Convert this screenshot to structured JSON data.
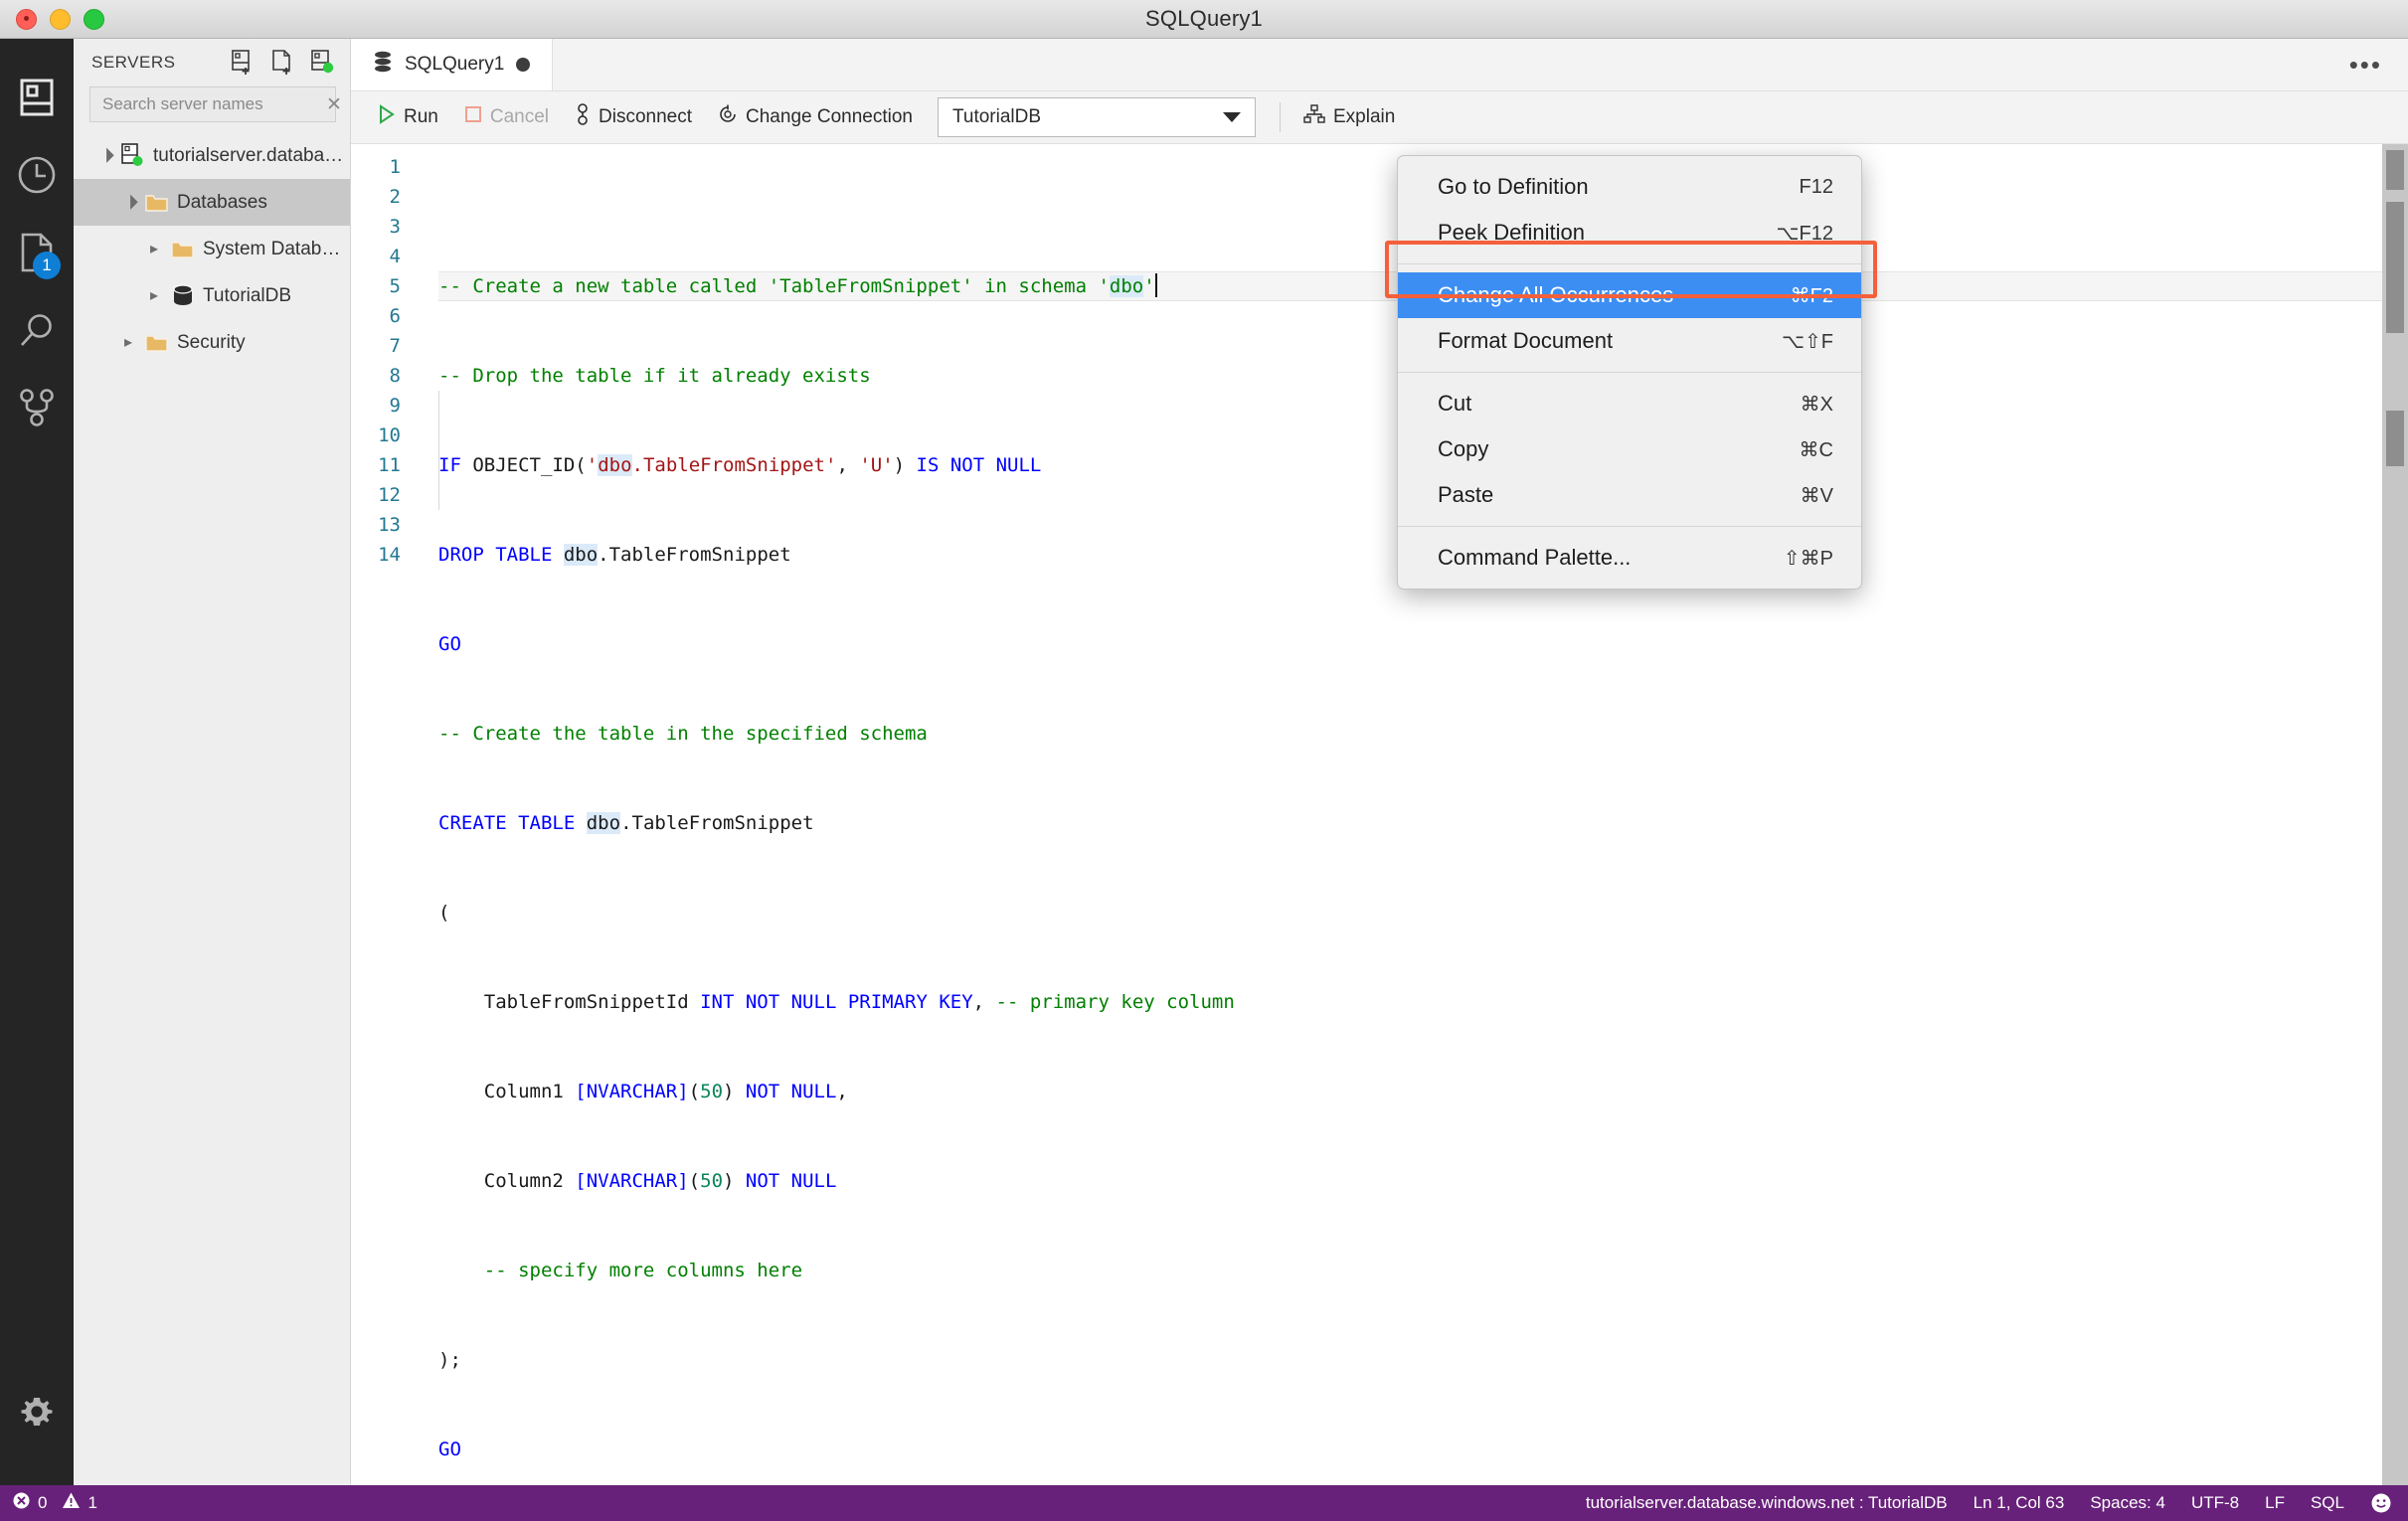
{
  "window": {
    "title": "SQLQuery1"
  },
  "activitybar": {
    "items": [
      {
        "name": "servers-icon",
        "label": "Servers"
      },
      {
        "name": "history-clock-icon",
        "label": "Query History"
      },
      {
        "name": "file-document-icon",
        "label": "Open Editors",
        "badge": "1"
      },
      {
        "name": "search-icon",
        "label": "Search"
      },
      {
        "name": "source-control-icon",
        "label": "Source Control"
      }
    ],
    "settings_label": "Manage"
  },
  "sidebar": {
    "title": "SERVERS",
    "actions": [
      {
        "name": "new-connection-icon",
        "label": "New Connection"
      },
      {
        "name": "new-query-icon",
        "label": "New Query"
      },
      {
        "name": "new-server-group-icon",
        "label": "New Server Group"
      }
    ],
    "search": {
      "placeholder": "Search server names",
      "value": "",
      "clear_label": "✕"
    },
    "tree": [
      {
        "label": "tutorialserver.database.windows.n...",
        "icon": "server-connected-icon",
        "depth": 0,
        "state": "open",
        "selected": false
      },
      {
        "label": "Databases",
        "icon": "folder-icon",
        "depth": 1,
        "state": "open",
        "selected": true
      },
      {
        "label": "System Databases",
        "icon": "folder-icon",
        "depth": 2,
        "state": "closed",
        "selected": false
      },
      {
        "label": "TutorialDB",
        "icon": "database-icon",
        "depth": 2,
        "state": "closed",
        "selected": false
      },
      {
        "label": "Security",
        "icon": "folder-icon",
        "depth": 1,
        "state": "closed",
        "selected": false
      }
    ]
  },
  "tabs": [
    {
      "label": "SQLQuery1",
      "icon": "database-icon",
      "dirty": true,
      "active": true
    }
  ],
  "tabbar": {
    "more_label": "•••"
  },
  "toolbar": {
    "run_label": "Run",
    "cancel_label": "Cancel",
    "disconnect_label": "Disconnect",
    "change_connection_label": "Change Connection",
    "database_selected": "TutorialDB",
    "explain_label": "Explain"
  },
  "editor": {
    "line_count": 14,
    "line_numbers": [
      "1",
      "2",
      "3",
      "4",
      "5",
      "6",
      "7",
      "8",
      "9",
      "10",
      "11",
      "12",
      "13",
      "14"
    ],
    "lines": [
      "-- Create a new table called 'TableFromSnippet' in schema 'dbo'",
      "-- Drop the table if it already exists",
      "IF OBJECT_ID('dbo.TableFromSnippet', 'U') IS NOT NULL",
      "DROP TABLE dbo.TableFromSnippet",
      "GO",
      "-- Create the table in the specified schema",
      "CREATE TABLE dbo.TableFromSnippet",
      "(",
      "    TableFromSnippetId INT NOT NULL PRIMARY KEY, -- primary key column",
      "    Column1 [NVARCHAR](50) NOT NULL,",
      "    Column2 [NVARCHAR](50) NOT NULL",
      "    -- specify more columns here",
      ");",
      "GO"
    ]
  },
  "context_menu": {
    "items": [
      {
        "label": "Go to Definition",
        "key": "F12",
        "active": false,
        "separator_after": false
      },
      {
        "label": "Peek Definition",
        "key": "⌥F12",
        "active": false,
        "separator_after": true
      },
      {
        "label": "Change All Occurrences",
        "key": "⌘F2",
        "active": true,
        "separator_after": false
      },
      {
        "label": "Format Document",
        "key": "⌥⇧F",
        "active": false,
        "separator_after": true
      },
      {
        "label": "Cut",
        "key": "⌘X",
        "active": false,
        "separator_after": false
      },
      {
        "label": "Copy",
        "key": "⌘C",
        "active": false,
        "separator_after": false
      },
      {
        "label": "Paste",
        "key": "⌘V",
        "active": false,
        "separator_after": true
      },
      {
        "label": "Command Palette...",
        "key": "⇧⌘P",
        "active": false,
        "separator_after": false
      }
    ],
    "highlight_color": "#f4603c"
  },
  "statusbar": {
    "errors": "0",
    "warnings": "1",
    "connection": "tutorialserver.database.windows.net : TutorialDB",
    "cursor": "Ln 1, Col 63",
    "indentation": "Spaces: 4",
    "encoding": "UTF-8",
    "eol": "LF",
    "language": "SQL",
    "feedback": "☺",
    "background": "#68217a"
  }
}
